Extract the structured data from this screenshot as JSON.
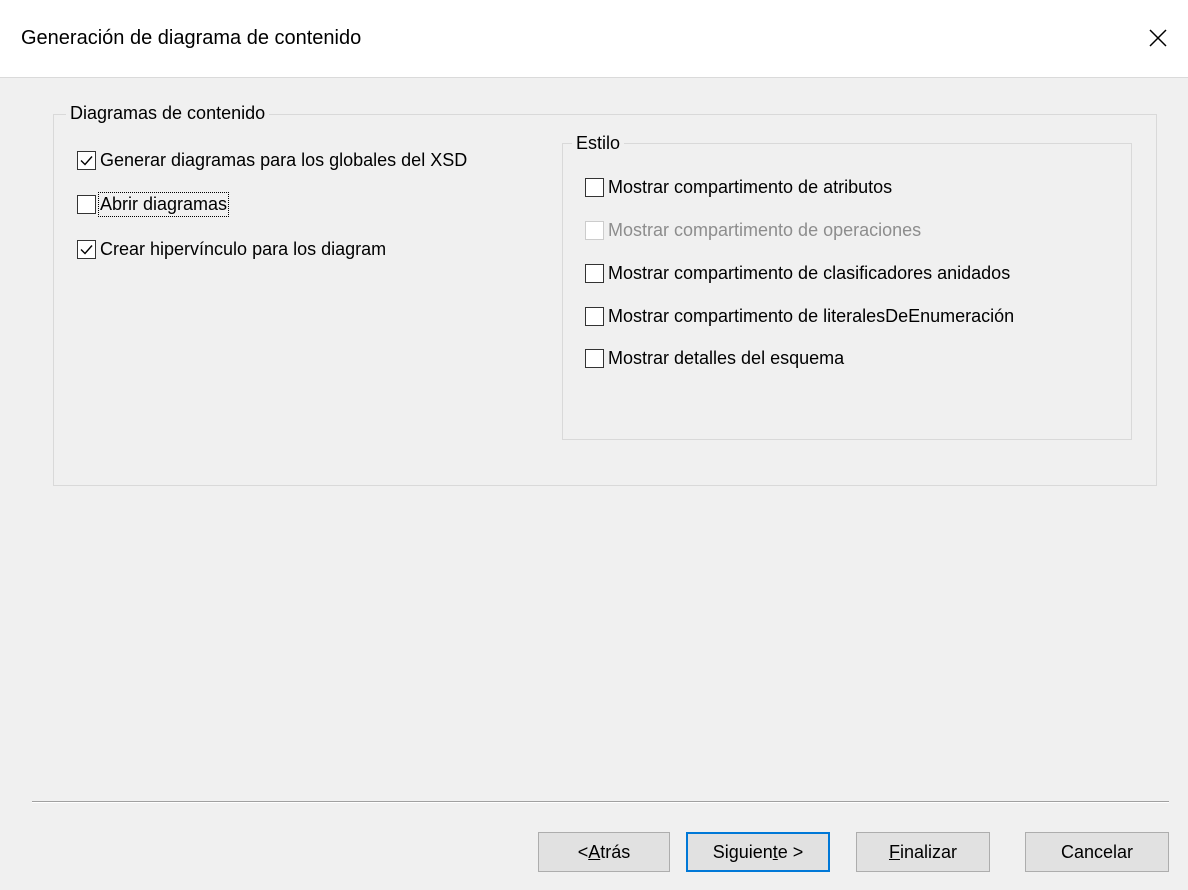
{
  "window": {
    "title": "Generación de diagrama de contenido",
    "close_icon": "close-icon"
  },
  "content_group": {
    "legend": "Diagramas de contenido",
    "options": [
      {
        "label": "Generar diagramas para los globales del XSD",
        "checked": true
      },
      {
        "label": "Abrir diagramas",
        "checked": false,
        "focused": true
      },
      {
        "label": "Crear hipervínculo para los diagram",
        "checked": true
      }
    ]
  },
  "style_group": {
    "legend": "Estilo",
    "options": [
      {
        "label": "Mostrar compartimento de atributos",
        "checked": false,
        "enabled": true
      },
      {
        "label": "Mostrar compartimento de operaciones",
        "checked": false,
        "enabled": false
      },
      {
        "label": "Mostrar compartimento de clasificadores anidados",
        "checked": false,
        "enabled": true
      },
      {
        "label": "Mostrar compartimento de literalesDeEnumeración",
        "checked": false,
        "enabled": true
      },
      {
        "label": "Mostrar detalles del esquema",
        "checked": false,
        "enabled": true
      }
    ]
  },
  "buttons": {
    "back": {
      "prefix": "< ",
      "accel": "A",
      "rest": "trás"
    },
    "next": {
      "prefix": "Siguien",
      "accel": "t",
      "rest": "e >"
    },
    "finish": {
      "prefix": "",
      "accel": "F",
      "rest": "inalizar"
    },
    "cancel": {
      "label": "Cancelar"
    }
  },
  "colors": {
    "dialog_bg": "#f0f0f0",
    "titlebar_bg": "#ffffff",
    "default_button_border": "#0078d7"
  }
}
